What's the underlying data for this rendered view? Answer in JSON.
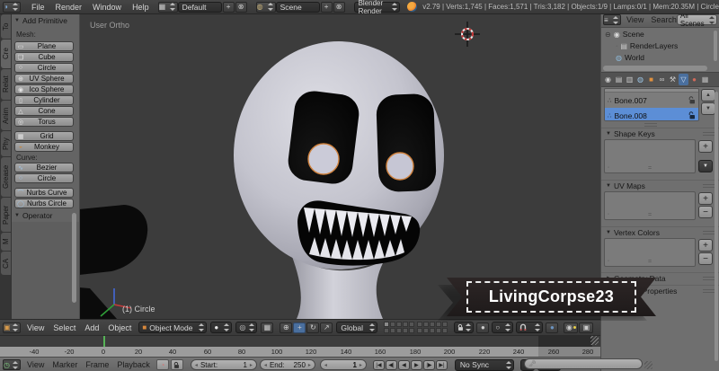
{
  "topbar": {
    "menus": {
      "file": "File",
      "render": "Render",
      "window": "Window",
      "help": "Help"
    },
    "layout": {
      "value": "Default"
    },
    "scene": {
      "value": "Scene"
    },
    "engine": {
      "value": "Blender Render"
    },
    "stats": "v2.79 | Verts:1,745 | Faces:1,571 | Tris:3,182 | Objects:1/9 | Lamps:0/1 | Mem:20.35M | Circle"
  },
  "toolshelf": {
    "tabs": [
      "To",
      "Cre",
      "Relat",
      "Anim",
      "Phy",
      "Grease",
      "Paper",
      "M",
      "CA"
    ],
    "add_primitive": {
      "title": "Add Primitive",
      "mesh_label": "Mesh:",
      "mesh_buttons": [
        "Plane",
        "Cube",
        "Circle",
        "UV Sphere",
        "Ico Sphere",
        "Cylinder",
        "Cone",
        "Torus",
        "Grid",
        "Monkey"
      ],
      "curve_label": "Curve:",
      "curve_buttons": [
        "Bezier",
        "Circle",
        "Nurbs Curve",
        "Nurbs Circle"
      ]
    },
    "operator_title": "Operator"
  },
  "viewport": {
    "view_label": "User Ortho",
    "selected_label": "(1) Circle",
    "header": {
      "menus": [
        "View",
        "Select",
        "Add",
        "Object"
      ],
      "mode": "Object Mode",
      "orientation": "Global"
    }
  },
  "outliner": {
    "menus": [
      "View",
      "Search"
    ],
    "display_filter": "All Scenes",
    "tree": [
      {
        "label": "Scene"
      },
      {
        "label": "RenderLayers"
      },
      {
        "label": "World"
      }
    ]
  },
  "properties": {
    "vertex_groups": [
      {
        "name": "Bone.007"
      },
      {
        "name": "Bone.008"
      }
    ],
    "panels": {
      "shape_keys": "Shape Keys",
      "uv_maps": "UV Maps",
      "vertex_colors": "Vertex Colors",
      "geometry_data": "Geometry Data",
      "custom_properties": "Custom Properties"
    }
  },
  "timeline": {
    "menus": [
      "View",
      "Marker",
      "Frame",
      "Playback"
    ],
    "ruler_ticks": [
      "-40",
      "-20",
      "0",
      "20",
      "40",
      "60",
      "80",
      "100",
      "120",
      "140",
      "160",
      "180",
      "200",
      "220",
      "240",
      "260",
      "280"
    ],
    "start_label": "Start:",
    "start_value": "1",
    "end_label": "End:",
    "end_value": "250",
    "current_frame": "1",
    "sync_mode": "No Sync"
  },
  "watermark": "LivingCorpse23",
  "colors": {
    "selection_blue": "#5c8ed6",
    "selection_outline_orange": "#d0833f",
    "frame_cursor_green": "#54b154",
    "header_active_blue": "#4a6f9e"
  }
}
